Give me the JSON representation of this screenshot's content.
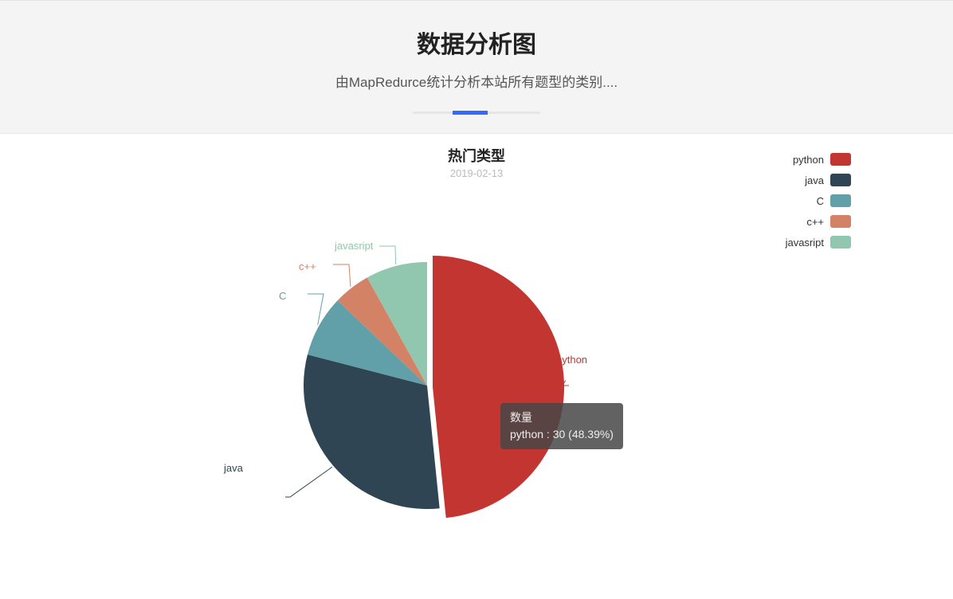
{
  "header": {
    "title": "数据分析图",
    "subtitle": "由MapRedurce统计分析本站所有题型的类别...."
  },
  "chart": {
    "title": "热门类型",
    "date": "2019-02-13"
  },
  "legend": [
    {
      "name": "python",
      "color": "#c23531"
    },
    {
      "name": "java",
      "color": "#2f4554"
    },
    {
      "name": "C",
      "color": "#61a0a8"
    },
    {
      "name": "c++",
      "color": "#d48265"
    },
    {
      "name": "javasript",
      "color": "#91c7ae"
    }
  ],
  "tooltip": {
    "series": "数量",
    "detail": "python : 30 (48.39%)"
  },
  "chart_data": {
    "type": "pie",
    "title": "热门类型",
    "subtitle": "2019-02-13",
    "series_name": "数量",
    "slices": [
      {
        "name": "python",
        "value": 30,
        "percent": 48.39,
        "color": "#c23531"
      },
      {
        "name": "java",
        "value": 19,
        "percent": 30.65,
        "color": "#2f4554"
      },
      {
        "name": "C",
        "value": 5,
        "percent": 8.06,
        "color": "#61a0a8"
      },
      {
        "name": "c++",
        "value": 3,
        "percent": 4.84,
        "color": "#d48265"
      },
      {
        "name": "javasript",
        "value": 5,
        "percent": 8.06,
        "color": "#91c7ae"
      }
    ]
  }
}
